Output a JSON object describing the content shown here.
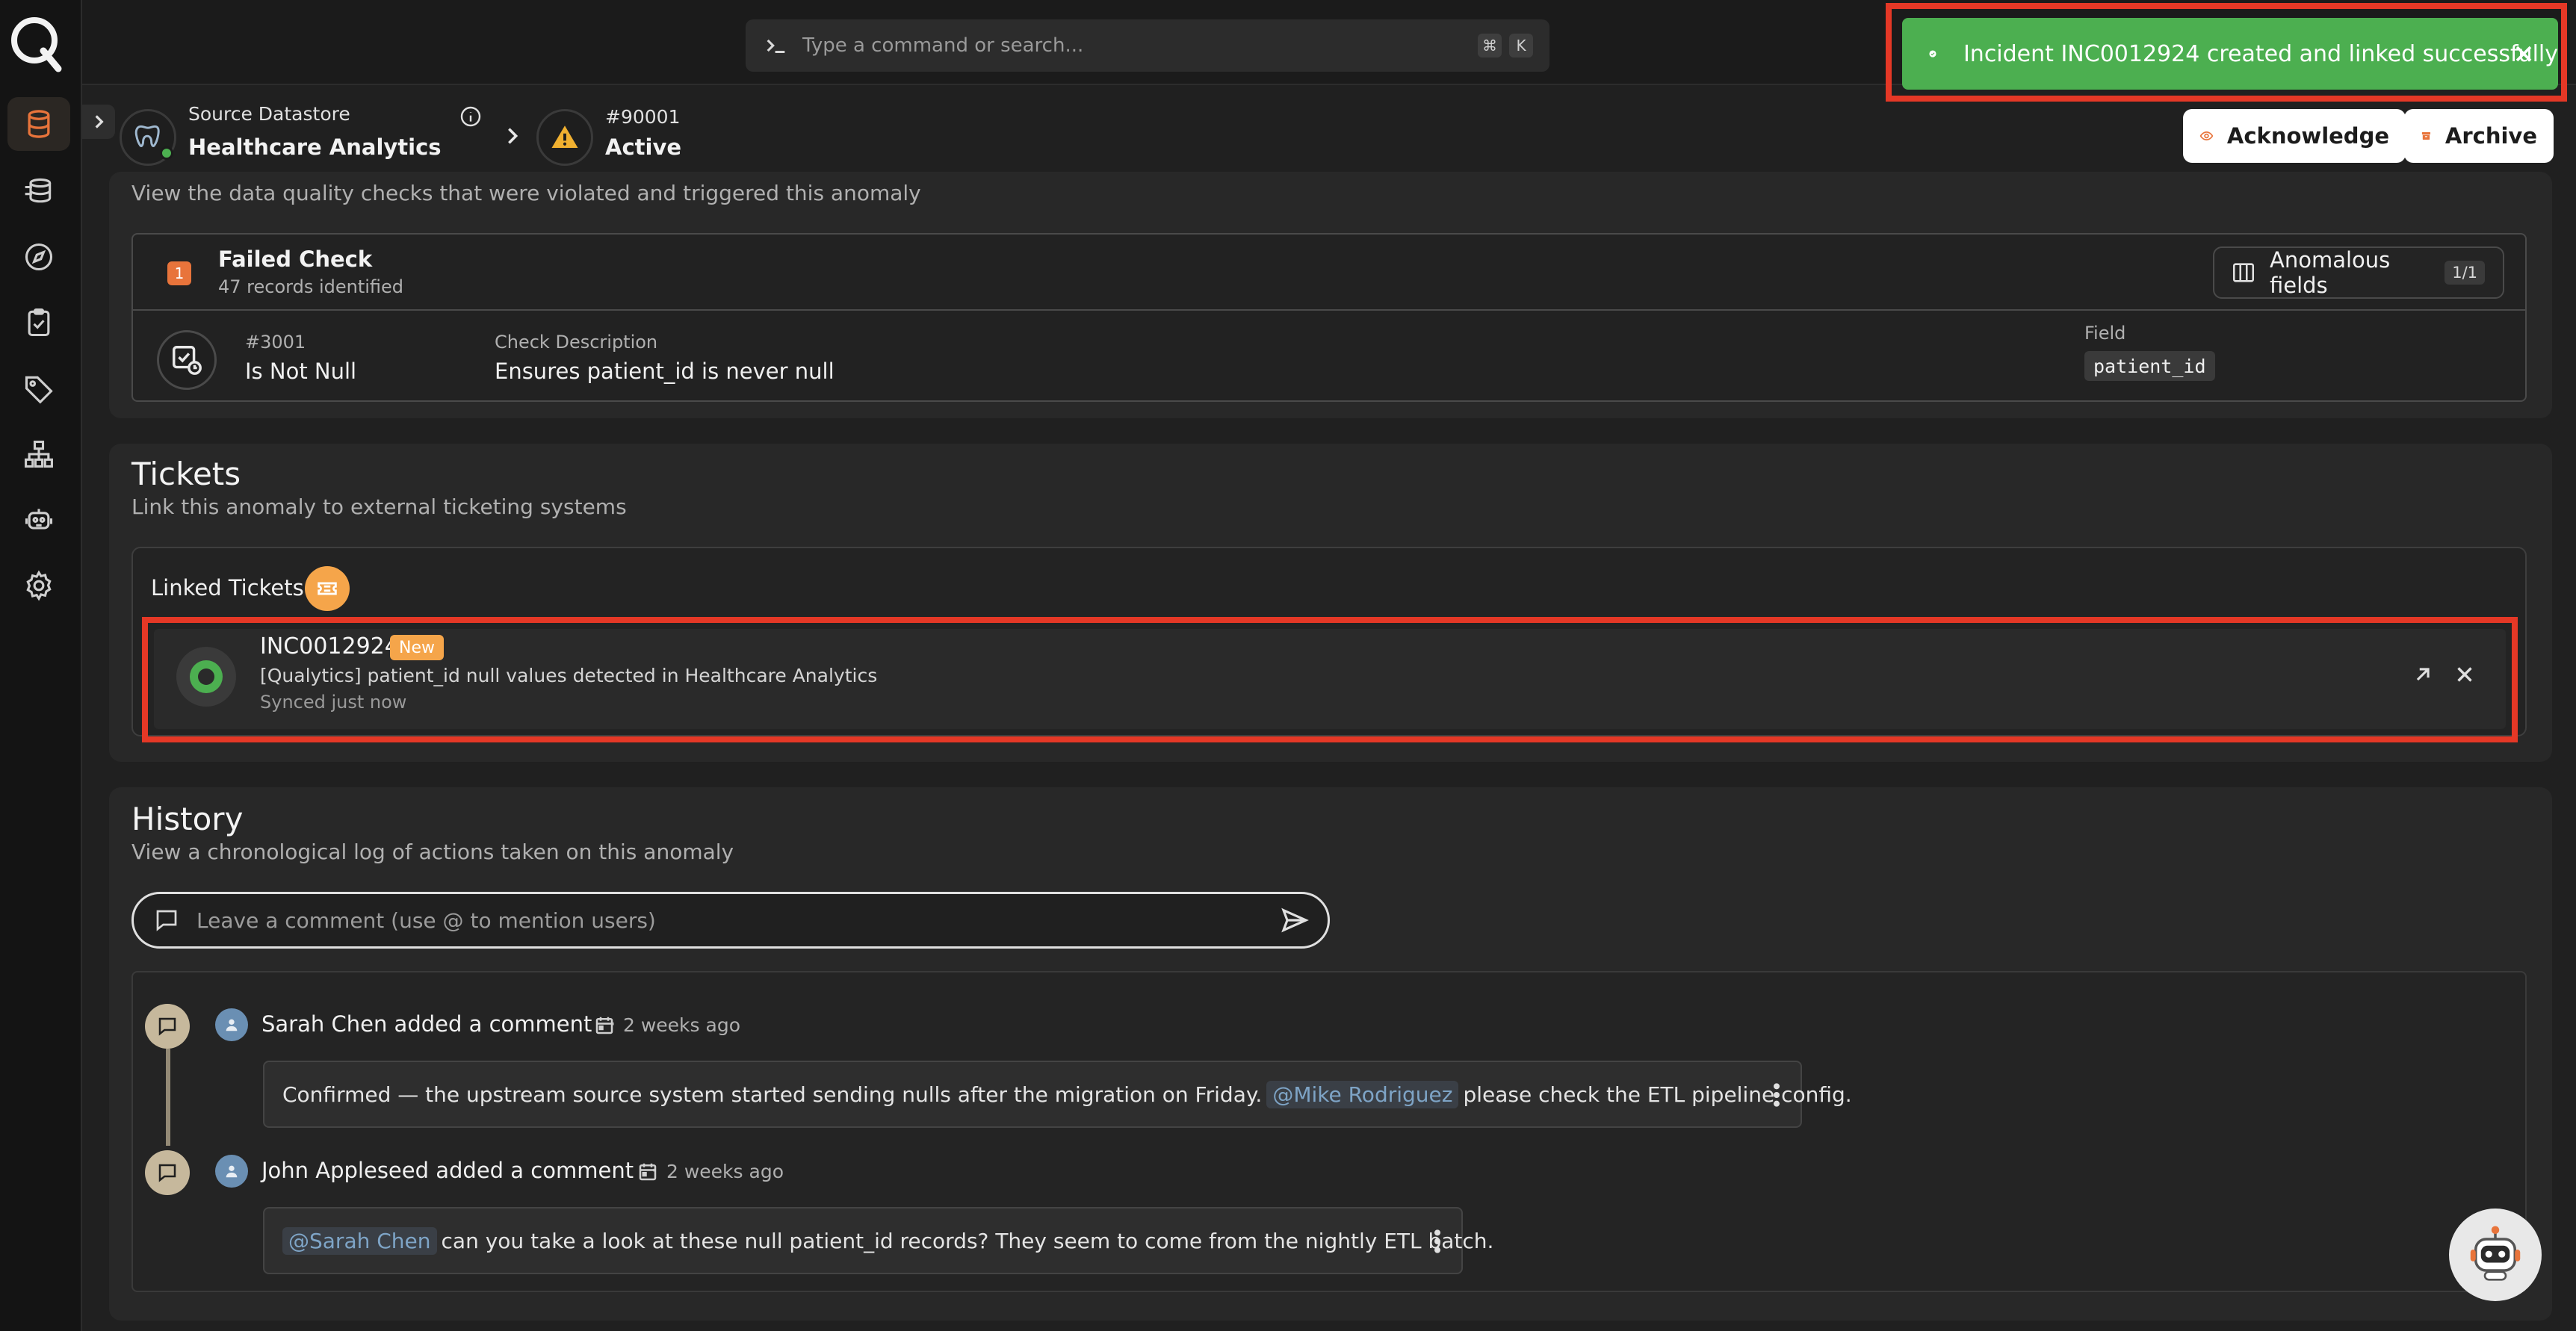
{
  "command_bar": {
    "placeholder": "Type a command or search...",
    "key1": "⌘",
    "key2": "K"
  },
  "breadcrumb": {
    "datastore_label": "Source Datastore",
    "datastore_name": "Healthcare Analytics",
    "anomaly_id": "#90001",
    "anomaly_status": "Active"
  },
  "actions": {
    "acknowledge": "Acknowledge",
    "archive": "Archive"
  },
  "toast": {
    "message": "Incident INC0012924 created and linked successfully"
  },
  "checks": {
    "subtitle": "View the data quality checks that were violated and triggered this anomaly",
    "failed_count": "1",
    "failed_title": "Failed Check",
    "records": "47 records identified",
    "anomalous_fields_label": "Anomalous fields",
    "anomalous_fields_count": "1/1",
    "check_id": "#3001",
    "check_name": "Is Not Null",
    "desc_label": "Check Description",
    "desc_value": "Ensures patient_id is never null",
    "field_label": "Field",
    "field_value": "patient_id"
  },
  "tickets": {
    "title": "Tickets",
    "subtitle": "Link this anomaly to external ticketing systems",
    "linked_label": "Linked Tickets",
    "ticket": {
      "id": "INC0012924",
      "status": "New",
      "summary": "[Qualytics] patient_id null values detected in Healthcare Analytics",
      "synced": "Synced just now"
    }
  },
  "history": {
    "title": "History",
    "subtitle": "View a chronological log of actions taken on this anomaly",
    "comment_placeholder": "Leave a comment (use @ to mention users)",
    "entries": [
      {
        "user": "Sarah Chen",
        "action": "added a comment",
        "time": "2 weeks ago",
        "text_before": "Confirmed — the upstream source system started sending nulls after the migration on Friday.",
        "mention": "@Mike Rodriguez",
        "text_after": "please check the ETL pipeline config."
      },
      {
        "user": "John Appleseed",
        "action": "added a comment",
        "time": "2 weeks ago",
        "text_before": "",
        "mention": "@Sarah Chen",
        "text_after": "can you take a look at these null patient_id records? They seem to come from the nightly ETL batch."
      }
    ]
  },
  "colors": {
    "accent": "#e8743b",
    "success": "#4caf50",
    "highlight": "#e53826",
    "ticket": "#f5a54a"
  },
  "icons": [
    "logo-icon",
    "database-icon",
    "datastores-icon",
    "compass-icon",
    "checklist-icon",
    "tag-icon",
    "hierarchy-icon",
    "robot-icon",
    "gear-icon"
  ]
}
